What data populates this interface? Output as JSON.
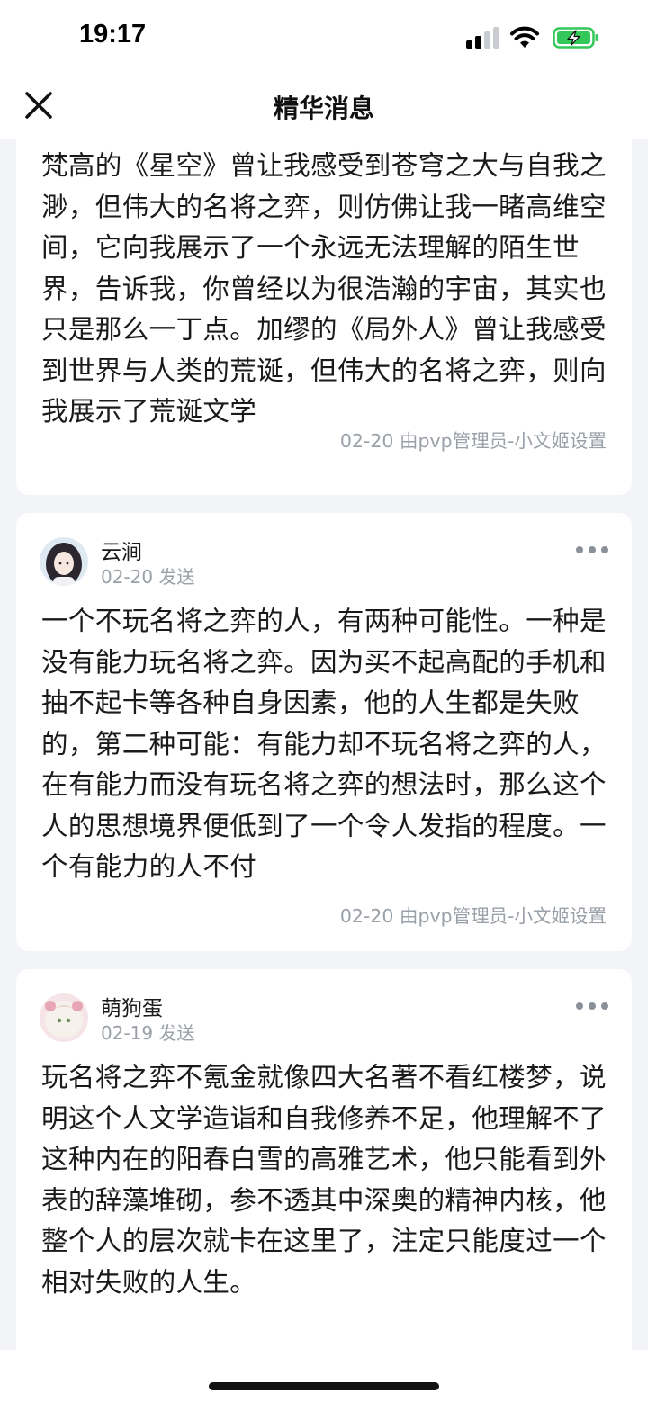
{
  "status_bar": {
    "time": "19:17",
    "icons": [
      "signal-icon",
      "wifi-icon",
      "battery-charging-icon"
    ],
    "battery_color": "#34c759"
  },
  "header": {
    "title": "精华消息",
    "close_icon": "close-icon"
  },
  "posts": [
    {
      "body": "梵高的《星空》曾让我感受到苍穹之大与自我之渺，但伟大的名将之弈，则仿佛让我一睹高维空间，它向我展示了一个永远无法理解的陌生世界，告诉我，你曾经以为很浩瀚的宇宙，其实也只是那么一丁点。加缪的《局外人》曾让我感受到世界与人类的荒诞，但伟大的名将之弈，则向我展示了荒诞文学",
      "footer": "02-20 由pvp管理员-小文姬设置"
    },
    {
      "author": "云涧",
      "meta": "02-20 发送",
      "body": "一个不玩名将之弈的人，有两种可能性。一种是没有能力玩名将之弈。因为买不起高配的手机和抽不起卡等各种自身因素，他的人生都是失败的，第二种可能：有能力却不玩名将之弈的人，在有能力而没有玩名将之弈的想法时，那么这个人的思想境界便低到了一个令人发指的程度。一个有能力的人不付",
      "footer": "02-20 由pvp管理员-小文姬设置"
    },
    {
      "author": "萌狗蛋",
      "meta": "02-19 发送",
      "body": "玩名将之弈不氪金就像四大名著不看红楼梦，说明这个人文学造诣和自我修养不足，他理解不了这种内在的阳春白雪的高雅艺术，他只能看到外表的辞藻堆砌，参不透其中深奥的精神内核，他整个人的层次就卡在这里了，注定只能度过一个相对失败的人生。"
    }
  ]
}
